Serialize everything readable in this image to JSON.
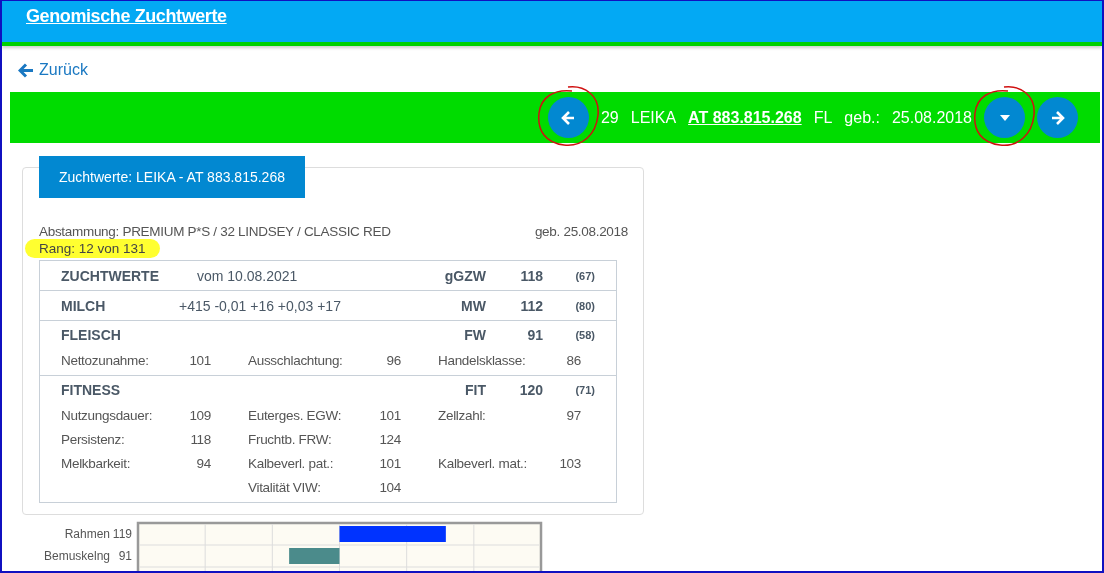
{
  "header": {
    "title": "Genomische Zuchtwerte"
  },
  "back_link": {
    "label": "Zurück"
  },
  "animal_bar": {
    "number": "29",
    "name": "LEIKA",
    "id": "AT 883.815.268",
    "breed": "FL",
    "born_label": "geb.:",
    "born": "25.08.2018",
    "buttons": [
      {
        "kind": "prev",
        "circled": true
      },
      {
        "kind": "menu",
        "circled": true
      },
      {
        "kind": "next",
        "circled": false
      }
    ]
  },
  "card": {
    "tab": "Zuchtwerte: LEIKA - AT 883.815.268",
    "pedigree": "Abstammung: PREMIUM P*S / 32 LINDSEY / CLASSIC RED",
    "born": "geb. 25.08.2018",
    "rank": "Rang: 12 von 131",
    "rank_highlighted": true
  },
  "sections": [
    {
      "title": "ZUCHTWERTE",
      "detail": "vom 10.08.2021",
      "key": "gGZW",
      "value": "118",
      "reliability": "(67)"
    },
    {
      "title": "MILCH",
      "detail": "+415 -0,01 +16 +0,03 +17",
      "key": "MW",
      "value": "112",
      "reliability": "(80)"
    },
    {
      "title": "FLEISCH",
      "key": "FW",
      "value": "91",
      "reliability": "(58)",
      "rows": [
        [
          {
            "label": "Nettozunahme:",
            "value": "101"
          },
          {
            "label": "Ausschlachtung:",
            "value": "96"
          },
          {
            "label": "Handelsklasse:",
            "value": "86"
          }
        ]
      ]
    },
    {
      "title": "FITNESS",
      "key": "FIT",
      "value": "120",
      "reliability": "(71)",
      "rows": [
        [
          {
            "label": "Nutzungsdauer:",
            "value": "109"
          },
          {
            "label": "Euterges. EGW:",
            "value": "101"
          },
          {
            "label": "Zellzahl:",
            "value": "97"
          }
        ],
        [
          {
            "label": "Persistenz:",
            "value": "118"
          },
          {
            "label": "Fruchtb. FRW:",
            "value": "124"
          },
          null
        ],
        [
          {
            "label": "Melkbarkeit:",
            "value": "94"
          },
          {
            "label": "Kalbeverl. pat.:",
            "value": "101"
          },
          {
            "label": "Kalbeverl. mat.:",
            "value": "103"
          }
        ],
        [
          null,
          {
            "label": "Vitalität VIW:",
            "value": "104"
          },
          null
        ]
      ]
    }
  ],
  "chart": {
    "rows": [
      {
        "label": "Rahmen",
        "reading": "119",
        "color": "#0033ff"
      },
      {
        "label": "Bemuskelng",
        "reading": "91",
        "color": "#4b8b8b"
      }
    ]
  }
}
